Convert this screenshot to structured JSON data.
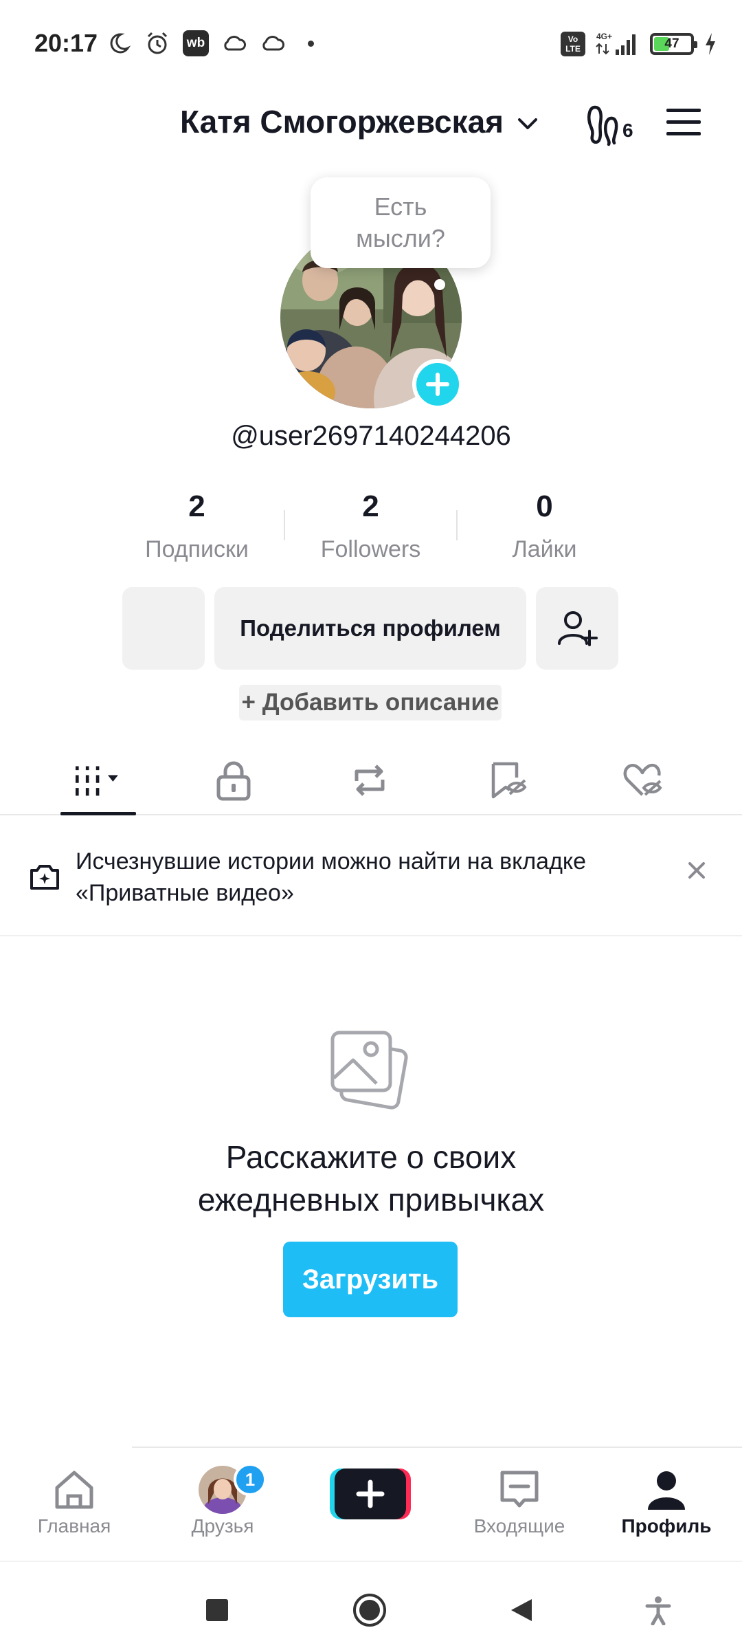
{
  "status_bar": {
    "time": "20:17",
    "wb_badge": "wb",
    "volte": "Vo\nLTE",
    "network": "4G+",
    "battery_level": 47,
    "battery_label": "47",
    "icons_left": [
      "moon-icon",
      "alarm-icon",
      "wb-app-icon",
      "cloud-icon",
      "cloud-icon",
      "dot-icon"
    ],
    "icons_right": [
      "volte-icon",
      "signal-icon",
      "battery-icon",
      "charging-icon"
    ]
  },
  "header": {
    "profile_name": "Катя Смогоржевская",
    "footprint_count": "6"
  },
  "profile": {
    "thought_bubble": "Есть мысли?",
    "username": "@user2697140244206"
  },
  "stats": [
    {
      "count": "2",
      "label": "Подписки"
    },
    {
      "count": "2",
      "label": "Followers"
    },
    {
      "count": "0",
      "label": "Лайки"
    }
  ],
  "actions": {
    "share_profile": "Поделиться профилем",
    "add_bio": "+ Добавить описание"
  },
  "tabs": [
    "videos-grid-tab",
    "private-tab",
    "reposts-tab",
    "saved-tab",
    "liked-tab"
  ],
  "notice": {
    "text": "Исчезнувшие истории можно найти на вкладке «Приватные видео»"
  },
  "empty_state": {
    "title_line1": "Расскажите о своих",
    "title_line2": "ежедневных привычках",
    "upload_button": "Загрузить"
  },
  "bottom_nav": {
    "home": "Главная",
    "friends": "Друзья",
    "friends_badge": "1",
    "inbox": "Входящие",
    "profile": "Профиль"
  },
  "colors": {
    "accent_cyan": "#20d5ec",
    "upload_blue": "#1fbdf5",
    "text_primary": "#161823",
    "text_secondary": "#8a8b91",
    "button_gray": "#f1f1f2"
  }
}
